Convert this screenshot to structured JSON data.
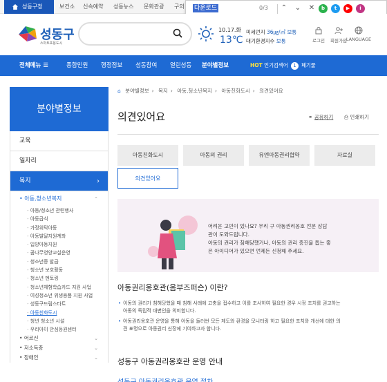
{
  "topbar": {
    "tabs": [
      "성동구청",
      "보건소",
      "신속예약",
      "성동뉴스",
      "문화관광",
      "구의"
    ]
  },
  "findbar": {
    "query": "다운로드",
    "count": "0/3"
  },
  "social": [
    "b",
    "t",
    "▶",
    "i"
  ],
  "header": {
    "logo": "성동구",
    "logo_sub": "스마트포용도시",
    "search_placeholder": "",
    "weather": {
      "date": "10.17.화",
      "temp": "13℃"
    },
    "dust1_label": "미세먼지",
    "dust1_value": "36㎍/㎥",
    "dust1_status": "보통",
    "dust2_label": "대기환경지수",
    "dust2_status": "보통",
    "utils": [
      "로그인",
      "회원가입",
      "LANGUAGE"
    ]
  },
  "gnb": {
    "all_menu": "전체메뉴",
    "items": [
      "종합민원",
      "행정정보",
      "성동참여",
      "열린성동",
      "분야별정보"
    ],
    "hot_label": "HOT",
    "hot_text": "인기검색어",
    "rank_num": "1",
    "rank_text": "폐기물"
  },
  "side": {
    "title": "분야별정보",
    "items": [
      "교육",
      "일자리",
      "복지"
    ],
    "sub_head": "아동,청소년복지",
    "sub_links": [
      "아동/청소년 관련행사",
      "아동급식",
      "가정위탁아동",
      "아동발달지원계좌",
      "입양아동지원",
      "꿈나무영양교실운영",
      "청소년증 발급",
      "청소년 보호활동",
      "청소년 멘토링",
      "청소년체험학습카드 지원 사업",
      "여성청소년 위생용품 지원 사업",
      "성동구드림스타트",
      "아동친화도시",
      "청년 청소년 시설",
      "우리아이 안심등원센터"
    ],
    "groups": [
      "어르신",
      "저소득층",
      "장애인"
    ]
  },
  "content": {
    "breadcrumb": [
      "분야별정보",
      "복지",
      "아동,청소년복지",
      "아동친화도시",
      "의견있어요"
    ],
    "title": "의견있어요",
    "share": "공유하기",
    "print": "인쇄하기",
    "tabs": [
      "아동친화도시",
      "아동의 권리",
      "유엔아동권리협약",
      "자료실",
      "의견있어요"
    ],
    "banner_lines": [
      "어려운 고민이 있나요? 우리 구 아동권리옹호 전문 상담",
      "관이 도와드립니다.",
      "아동의 권리가 침해당했거나, 아동의 권리 증진을 돕는 좋",
      "은 아이디어가 있으면 언제든 신청해 주세요."
    ],
    "section1_title": "아동권리옹호관(옴부즈퍼슨) 이란?",
    "section1_bullets": [
      "이동의 권리가 침해당했을 때 침해 사례에 고충을 접수하고 이를 조사하여 필요한 경우 시정 조치를 권고하는",
      "아동의 독립적 대변인을 의미합니다.",
      "아동권리옹호관 운영을 통해 아동을 둘러싼 모든 제도와 환경을 모니터링 하고 필요한 조치와 개선에 대한 의",
      "견 표명으로 아동권리 신장에 기여하고자 합니다."
    ],
    "section2_title": "성동구 아동권리옹호관 운영 안내",
    "section3_title": "성동구 아동권리옹호관 운영 절차"
  }
}
